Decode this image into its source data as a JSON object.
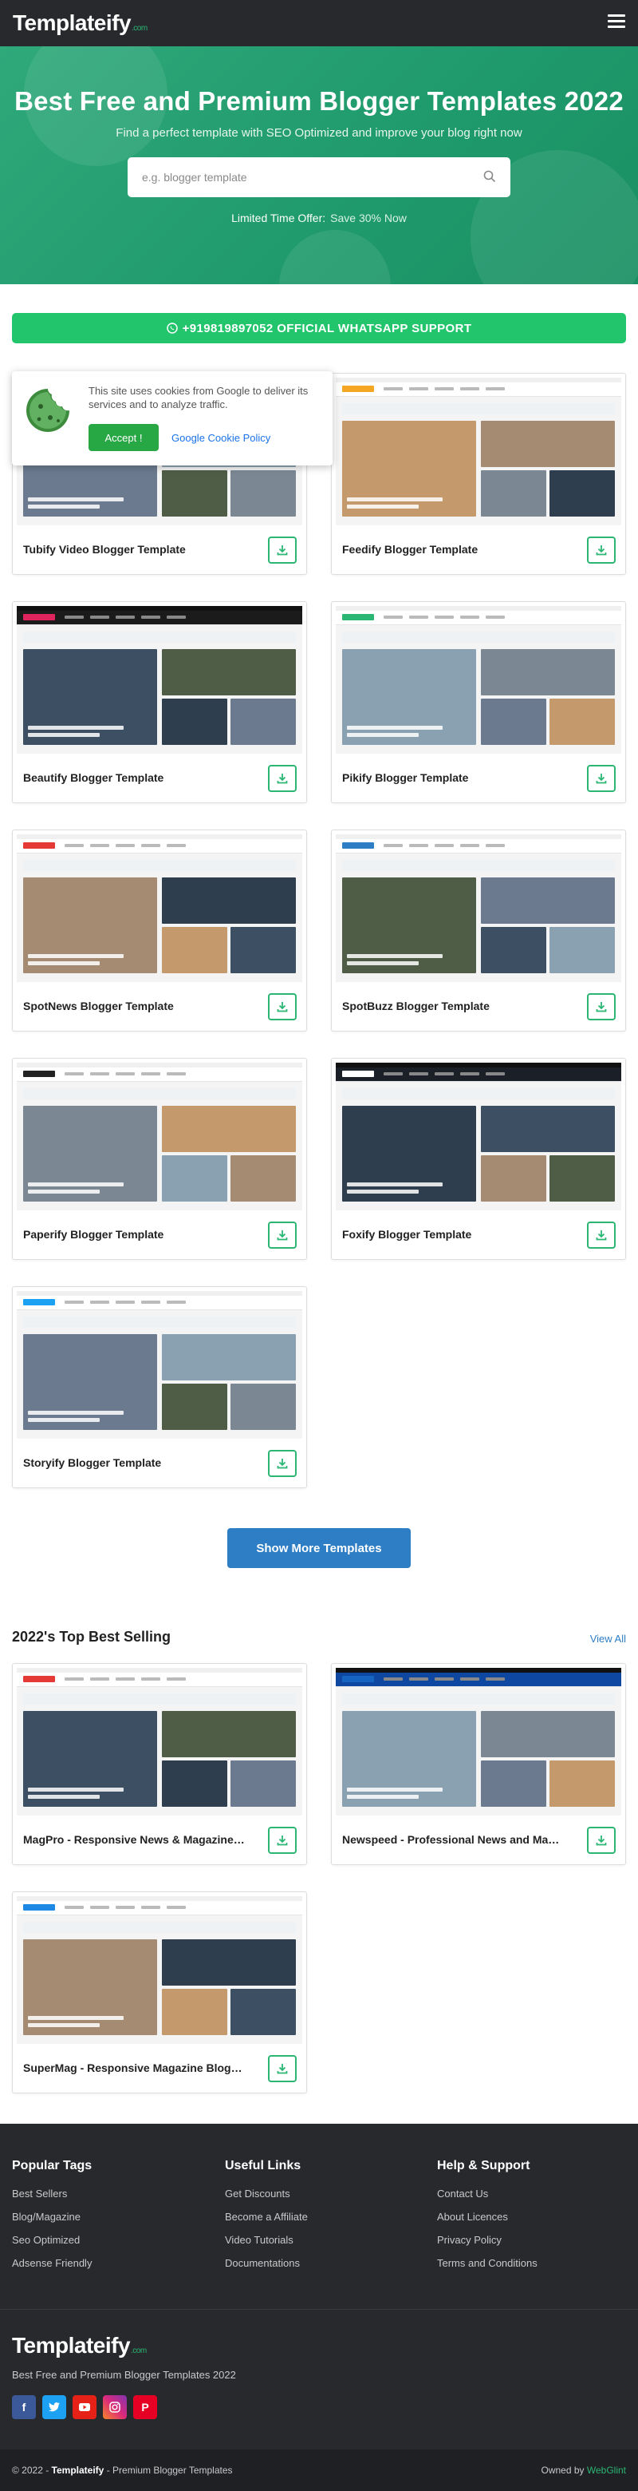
{
  "header": {
    "logo": "Templateify",
    "logo_suffix": ".com"
  },
  "hero": {
    "title": "Best Free and Premium Blogger Templates 2022",
    "subtitle": "Find a perfect template with SEO Optimized and improve your blog right now",
    "search_placeholder": "e.g. blogger template",
    "offer_label": "Limited Time Offer:",
    "offer_value": "Save 30% Now"
  },
  "whatsapp": {
    "label": "+919819897052 OFFICIAL WHATSAPP SUPPORT"
  },
  "cookie": {
    "text": "This site uses cookies from Google to deliver its services and to analyze traffic.",
    "accept": "Accept !",
    "policy": "Google Cookie Policy"
  },
  "templates": [
    {
      "title": "Tubify Video Blogger Template"
    },
    {
      "title": "Feedify Blogger Template"
    },
    {
      "title": "Beautify Blogger Template"
    },
    {
      "title": "Pikify Blogger Template"
    },
    {
      "title": "SpotNews Blogger Template"
    },
    {
      "title": "SpotBuzz Blogger Template"
    },
    {
      "title": "Paperify Blogger Template"
    },
    {
      "title": "Foxify Blogger Template"
    },
    {
      "title": "Storyify Blogger Template"
    }
  ],
  "show_more": "Show More Templates",
  "best_selling": {
    "heading": "2022's Top Best Selling",
    "view_all": "View All",
    "items": [
      {
        "title": "MagPro - Responsive News & Magazine Blogger Template"
      },
      {
        "title": "Newspeed - Professional News and Magazine Blogger Template"
      },
      {
        "title": "SuperMag - Responsive Magazine Blogger Template"
      }
    ]
  },
  "footer": {
    "col1": {
      "heading": "Popular Tags",
      "links": [
        "Best Sellers",
        "Blog/Magazine",
        "Seo Optimized",
        "Adsense Friendly"
      ]
    },
    "col2": {
      "heading": "Useful Links",
      "links": [
        "Get Discounts",
        "Become a Affiliate",
        "Video Tutorials",
        "Documentations"
      ]
    },
    "col3": {
      "heading": "Help & Support",
      "links": [
        "Contact Us",
        "About Licences",
        "Privacy Policy",
        "Terms and Conditions"
      ]
    },
    "tagline": "Best Free and Premium Blogger Templates 2022",
    "copy_prefix": "© 2022 -",
    "copy_brand": "Templateify",
    "copy_suffix": "- Premium Blogger Templates",
    "owned_by": "Owned by",
    "owner": "WebGlint"
  },
  "colors": {
    "brand_green": "#2bb673",
    "whatsapp": "#22c56b",
    "button_blue": "#2d7ec4",
    "dark": "#27292d"
  }
}
